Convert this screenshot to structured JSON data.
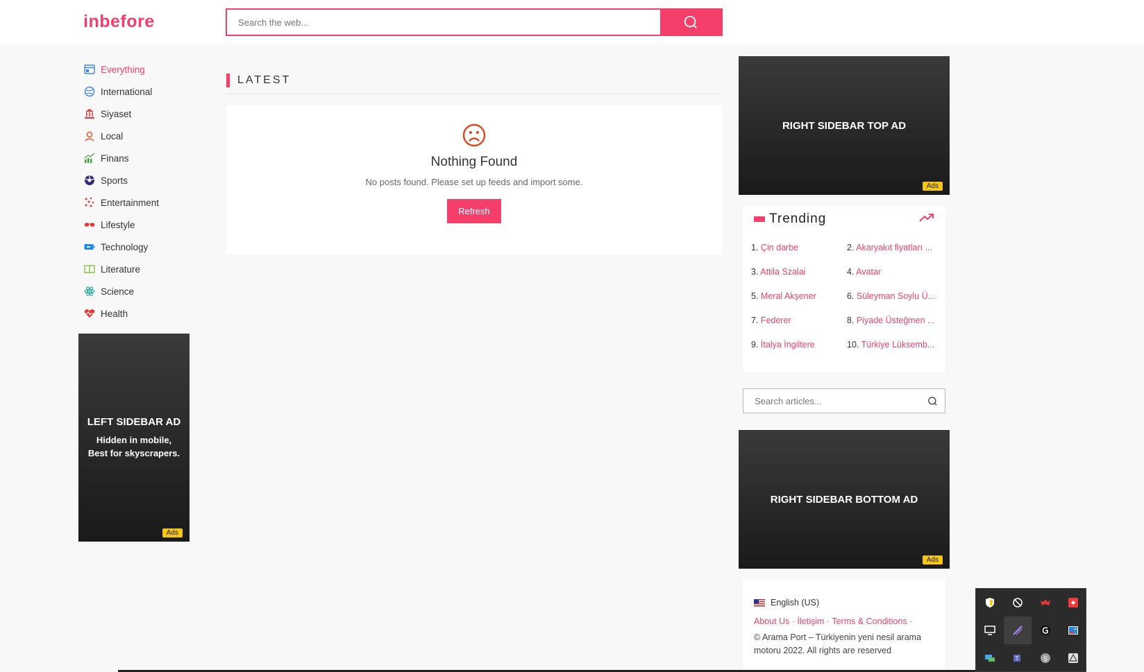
{
  "header": {
    "logo": "inbefore",
    "search_placeholder": "Search the web..."
  },
  "nav": {
    "items": [
      {
        "label": "Everything",
        "icon": "newspaper-icon",
        "active": true
      },
      {
        "label": "International",
        "icon": "globe-icon"
      },
      {
        "label": "Siyaset",
        "icon": "capitol-icon"
      },
      {
        "label": "Local",
        "icon": "location-pin-icon"
      },
      {
        "label": "Finans",
        "icon": "chart-up-icon"
      },
      {
        "label": "Sports",
        "icon": "ball-icon"
      },
      {
        "label": "Entertainment",
        "icon": "confetti-icon"
      },
      {
        "label": "Lifestyle",
        "icon": "sunglasses-icon"
      },
      {
        "label": "Technology",
        "icon": "battery-icon"
      },
      {
        "label": "Literature",
        "icon": "book-icon"
      },
      {
        "label": "Science",
        "icon": "atom-icon"
      },
      {
        "label": "Health",
        "icon": "heart-pulse-icon"
      }
    ]
  },
  "left_ad": {
    "title": "LEFT SIDEBAR AD",
    "subtitle": "Hidden in mobile, Best for skyscrapers.",
    "badge": "Ads"
  },
  "latest": {
    "title": "LATEST",
    "empty_title": "Nothing Found",
    "empty_text": "No posts found. Please set up feeds and import some.",
    "refresh_label": "Refresh"
  },
  "right_top_ad": {
    "title": "RIGHT SIDEBAR TOP AD",
    "badge": "Ads"
  },
  "trending": {
    "title": "Trending",
    "items": [
      {
        "num": "1.",
        "label": "Çin darbe"
      },
      {
        "num": "2.",
        "label": "Akaryakıt fiyatları ..."
      },
      {
        "num": "3.",
        "label": "Attila Szalai"
      },
      {
        "num": "4.",
        "label": "Avatar"
      },
      {
        "num": "5.",
        "label": "Meral Akşener"
      },
      {
        "num": "6.",
        "label": "Süleyman Soylu Ü..."
      },
      {
        "num": "7.",
        "label": "Federer"
      },
      {
        "num": "8.",
        "label": "Piyade Üsteğmen ..."
      },
      {
        "num": "9.",
        "label": "İtalya İngiltere"
      },
      {
        "num": "10.",
        "label": "Türkiye Lüksemb..."
      }
    ]
  },
  "article_search": {
    "placeholder": "Search articles..."
  },
  "right_bottom_ad": {
    "title": "RIGHT SIDEBAR BOTTOM AD",
    "badge": "Ads"
  },
  "footer": {
    "language": "English (US)",
    "links": [
      "About Us",
      "İletişim",
      "Terms & Conditions"
    ],
    "separator": " · ",
    "copyright": "© Arama Port – Türkiyenin yeni nesil arama motoru 2022. All rights are reserved"
  },
  "colors": {
    "accent": "#f43f6b",
    "ad_badge": "#f5c518",
    "ad_bg": "#2a2a2a"
  }
}
